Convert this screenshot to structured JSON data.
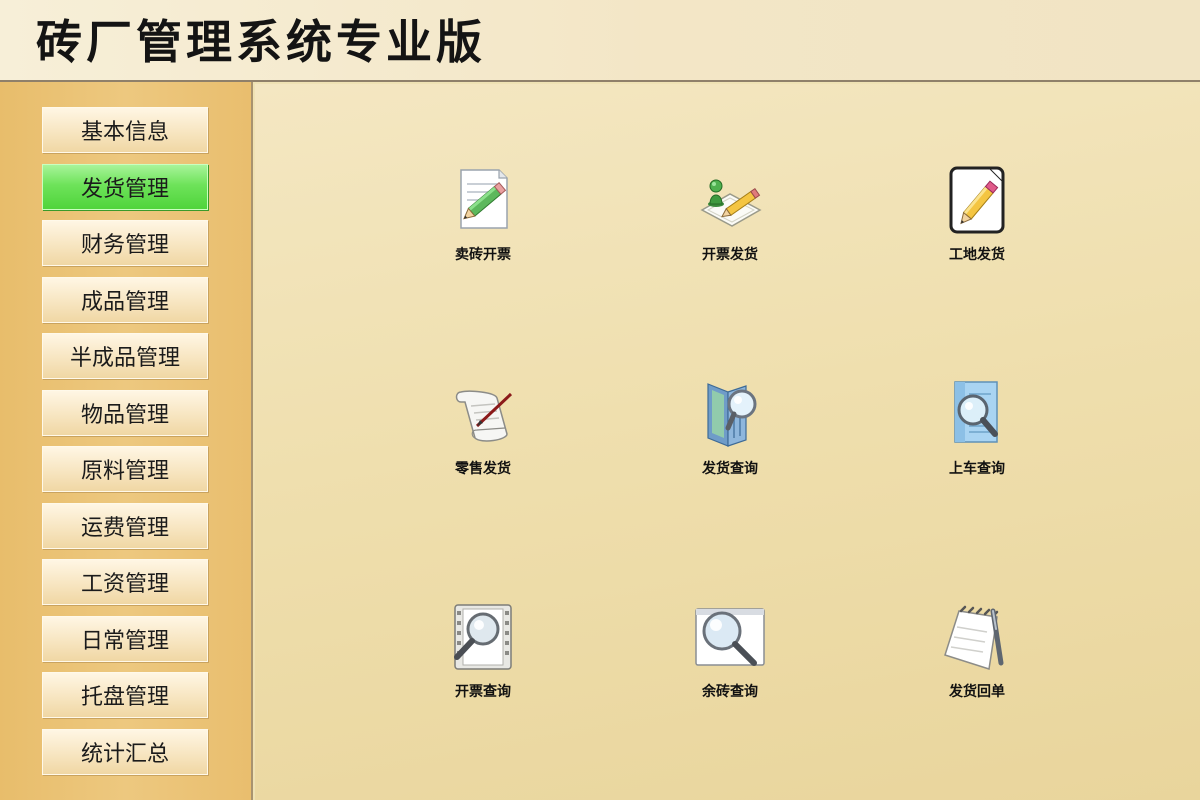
{
  "app": {
    "title": "砖厂管理系统专业版"
  },
  "sidebar": {
    "items": [
      {
        "label": "基本信息"
      },
      {
        "label": "发货管理",
        "active": true
      },
      {
        "label": "财务管理"
      },
      {
        "label": "成品管理"
      },
      {
        "label": "半成品管理"
      },
      {
        "label": "物品管理"
      },
      {
        "label": "原料管理"
      },
      {
        "label": "运费管理"
      },
      {
        "label": "工资管理"
      },
      {
        "label": "日常管理"
      },
      {
        "label": "托盘管理"
      },
      {
        "label": "统计汇总"
      }
    ]
  },
  "main": {
    "tiles": [
      {
        "label": "卖砖开票",
        "icon": "document-edit-icon"
      },
      {
        "label": "开票发货",
        "icon": "invoice-ship-icon"
      },
      {
        "label": "工地发货",
        "icon": "pencil-note-icon"
      },
      {
        "label": "零售发货",
        "icon": "scroll-quill-icon"
      },
      {
        "label": "发货查询",
        "icon": "folder-search-icon"
      },
      {
        "label": "上车查询",
        "icon": "doc-search-icon"
      },
      {
        "label": "开票查询",
        "icon": "film-search-icon"
      },
      {
        "label": "余砖查询",
        "icon": "window-search-icon"
      },
      {
        "label": "发货回单",
        "icon": "notepad-pen-icon"
      }
    ]
  },
  "colors": {
    "header_bg": "#f3e6c6",
    "sidebar_bg": "#edc87f",
    "content_bg": "#efdfae",
    "active_nav": "#6ee35a",
    "text": "#141414"
  }
}
